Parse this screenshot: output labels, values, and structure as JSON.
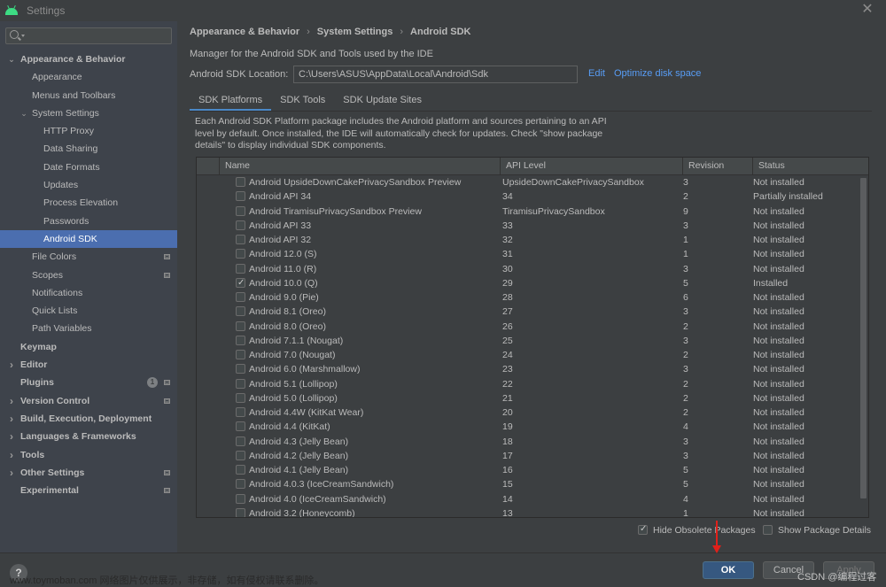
{
  "window": {
    "title": "Settings"
  },
  "search": {
    "placeholder": "",
    "value": ""
  },
  "sidebar": {
    "items": [
      {
        "label": "Appearance & Behavior",
        "level": 0,
        "arrow": "expanded",
        "bold": true
      },
      {
        "label": "Appearance",
        "level": 1
      },
      {
        "label": "Menus and Toolbars",
        "level": 1
      },
      {
        "label": "System Settings",
        "level": 1,
        "arrow": "expanded"
      },
      {
        "label": "HTTP Proxy",
        "level": 2
      },
      {
        "label": "Data Sharing",
        "level": 2
      },
      {
        "label": "Date Formats",
        "level": 2
      },
      {
        "label": "Updates",
        "level": 2
      },
      {
        "label": "Process Elevation",
        "level": 2
      },
      {
        "label": "Passwords",
        "level": 2
      },
      {
        "label": "Android SDK",
        "level": 2,
        "selected": true
      },
      {
        "label": "File Colors",
        "level": 1,
        "project_icon": true
      },
      {
        "label": "Scopes",
        "level": 1,
        "project_icon": true
      },
      {
        "label": "Notifications",
        "level": 1
      },
      {
        "label": "Quick Lists",
        "level": 1
      },
      {
        "label": "Path Variables",
        "level": 1
      },
      {
        "label": "Keymap",
        "level": 0,
        "bold": true
      },
      {
        "label": "Editor",
        "level": 0,
        "arrow": "collapsed",
        "bold": true
      },
      {
        "label": "Plugins",
        "level": 0,
        "bold": true,
        "badge": "1",
        "project_icon": true
      },
      {
        "label": "Version Control",
        "level": 0,
        "arrow": "collapsed",
        "bold": true,
        "project_icon": true
      },
      {
        "label": "Build, Execution, Deployment",
        "level": 0,
        "arrow": "collapsed",
        "bold": true
      },
      {
        "label": "Languages & Frameworks",
        "level": 0,
        "arrow": "collapsed",
        "bold": true
      },
      {
        "label": "Tools",
        "level": 0,
        "arrow": "collapsed",
        "bold": true
      },
      {
        "label": "Other Settings",
        "level": 0,
        "arrow": "collapsed",
        "bold": true,
        "project_icon": true
      },
      {
        "label": "Experimental",
        "level": 0,
        "bold": true,
        "project_icon": true
      }
    ]
  },
  "breadcrumb": [
    "Appearance & Behavior",
    "System Settings",
    "Android SDK"
  ],
  "main": {
    "description": "Manager for the Android SDK and Tools used by the IDE",
    "sdk_location_label": "Android SDK Location:",
    "sdk_location_value": "C:\\Users\\ASUS\\AppData\\Local\\Android\\Sdk",
    "edit_link": "Edit",
    "optimize_link": "Optimize disk space",
    "tabs": [
      {
        "label": "SDK Platforms",
        "active": true
      },
      {
        "label": "SDK Tools"
      },
      {
        "label": "SDK Update Sites"
      }
    ],
    "info_text": "Each Android SDK Platform package includes the Android platform and sources pertaining to an API level by default. Once installed, the IDE will automatically check for updates. Check \"show package details\" to display individual SDK components.",
    "table": {
      "columns": [
        "Name",
        "API Level",
        "Revision",
        "Status"
      ],
      "rows": [
        {
          "checked": false,
          "name": "Android UpsideDownCakePrivacySandbox Preview",
          "api": "UpsideDownCakePrivacySandbox",
          "revision": "3",
          "status": "Not installed"
        },
        {
          "checked": false,
          "name": "Android API 34",
          "api": "34",
          "revision": "2",
          "status": "Partially installed"
        },
        {
          "checked": false,
          "name": "Android TiramisuPrivacySandbox Preview",
          "api": "TiramisuPrivacySandbox",
          "revision": "9",
          "status": "Not installed"
        },
        {
          "checked": false,
          "name": "Android API 33",
          "api": "33",
          "revision": "3",
          "status": "Not installed"
        },
        {
          "checked": false,
          "name": "Android API 32",
          "api": "32",
          "revision": "1",
          "status": "Not installed"
        },
        {
          "checked": false,
          "name": "Android 12.0 (S)",
          "api": "31",
          "revision": "1",
          "status": "Not installed"
        },
        {
          "checked": false,
          "name": "Android 11.0 (R)",
          "api": "30",
          "revision": "3",
          "status": "Not installed"
        },
        {
          "checked": true,
          "name": "Android 10.0 (Q)",
          "api": "29",
          "revision": "5",
          "status": "Installed"
        },
        {
          "checked": false,
          "name": "Android 9.0 (Pie)",
          "api": "28",
          "revision": "6",
          "status": "Not installed"
        },
        {
          "checked": false,
          "name": "Android 8.1 (Oreo)",
          "api": "27",
          "revision": "3",
          "status": "Not installed"
        },
        {
          "checked": false,
          "name": "Android 8.0 (Oreo)",
          "api": "26",
          "revision": "2",
          "status": "Not installed"
        },
        {
          "checked": false,
          "name": "Android 7.1.1 (Nougat)",
          "api": "25",
          "revision": "3",
          "status": "Not installed"
        },
        {
          "checked": false,
          "name": "Android 7.0 (Nougat)",
          "api": "24",
          "revision": "2",
          "status": "Not installed"
        },
        {
          "checked": false,
          "name": "Android 6.0 (Marshmallow)",
          "api": "23",
          "revision": "3",
          "status": "Not installed"
        },
        {
          "checked": false,
          "name": "Android 5.1 (Lollipop)",
          "api": "22",
          "revision": "2",
          "status": "Not installed"
        },
        {
          "checked": false,
          "name": "Android 5.0 (Lollipop)",
          "api": "21",
          "revision": "2",
          "status": "Not installed"
        },
        {
          "checked": false,
          "name": "Android 4.4W (KitKat Wear)",
          "api": "20",
          "revision": "2",
          "status": "Not installed"
        },
        {
          "checked": false,
          "name": "Android 4.4 (KitKat)",
          "api": "19",
          "revision": "4",
          "status": "Not installed"
        },
        {
          "checked": false,
          "name": "Android 4.3 (Jelly Bean)",
          "api": "18",
          "revision": "3",
          "status": "Not installed"
        },
        {
          "checked": false,
          "name": "Android 4.2 (Jelly Bean)",
          "api": "17",
          "revision": "3",
          "status": "Not installed"
        },
        {
          "checked": false,
          "name": "Android 4.1 (Jelly Bean)",
          "api": "16",
          "revision": "5",
          "status": "Not installed"
        },
        {
          "checked": false,
          "name": "Android 4.0.3 (IceCreamSandwich)",
          "api": "15",
          "revision": "5",
          "status": "Not installed"
        },
        {
          "checked": false,
          "name": "Android 4.0 (IceCreamSandwich)",
          "api": "14",
          "revision": "4",
          "status": "Not installed"
        },
        {
          "checked": false,
          "name": "Android 3.2 (Honeycomb)",
          "api": "13",
          "revision": "1",
          "status": "Not installed"
        }
      ]
    },
    "hide_obsolete": {
      "label": "Hide Obsolete Packages",
      "checked": true
    },
    "show_details": {
      "label": "Show Package Details",
      "checked": false
    }
  },
  "footer": {
    "help": "?",
    "ok": "OK",
    "cancel": "Cancel",
    "apply": "Apply"
  },
  "watermarks": {
    "site": "www.toymoban.com 网络图片仅供展示，非存储，如有侵权请联系删除。",
    "csdn": "CSDN @编程过客"
  },
  "colors": {
    "accent": "#4b6eaf",
    "link": "#589df6",
    "ok_button": "#365880",
    "annotation_arrow": "#e0201a"
  }
}
